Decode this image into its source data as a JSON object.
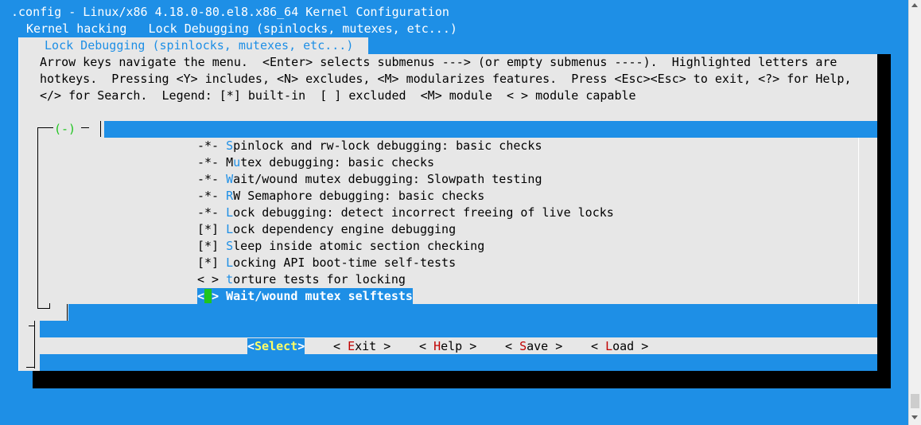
{
  "window": {
    "title": ".config - Linux/x86 4.18.0-80.el8.x86_64 Kernel Configuration",
    "breadcrumb": " Kernel hacking   Lock Debugging (spinlocks, mutexes, etc...)"
  },
  "dialog": {
    "title": " Lock Debugging (spinlocks, mutexes, etc...) ",
    "help_lines": [
      "Arrow keys navigate the menu.  <Enter> selects submenus ---> (or empty submenus ----).  Highlighted letters are",
      "hotkeys.  Pressing <Y> includes, <N> excludes, <M> modularizes features.  Press <Esc><Esc> to exit, <?> for Help,",
      "</> for Search.  Legend: [*] built-in  [ ] excluded  <M> module  < > module capable"
    ],
    "scroll_indicator": "(-)"
  },
  "menu": {
    "items": [
      {
        "prefix": "-*- ",
        "hotkey": "S",
        "rest": "pinlock and rw-lock debugging: basic checks"
      },
      {
        "prefix": "-*- M",
        "hotkey": "u",
        "rest": "tex debugging: basic checks"
      },
      {
        "prefix": "-*- ",
        "hotkey": "W",
        "rest": "ait/wound mutex debugging: Slowpath testing"
      },
      {
        "prefix": "-*- ",
        "hotkey": "R",
        "rest": "W Semaphore debugging: basic checks"
      },
      {
        "prefix": "-*- ",
        "hotkey": "L",
        "rest": "ock debugging: detect incorrect freeing of live locks"
      },
      {
        "prefix": "[*] ",
        "hotkey": "L",
        "rest": "ock dependency engine debugging"
      },
      {
        "prefix": "[*] ",
        "hotkey": "S",
        "rest": "leep inside atomic section checking"
      },
      {
        "prefix": "[*] ",
        "hotkey": "L",
        "rest": "ocking API boot-time self-tests"
      },
      {
        "prefix": "< > ",
        "hotkey": "t",
        "rest": "orture tests for locking"
      }
    ],
    "selected": {
      "open": "<",
      "mark": " ",
      "close": "> ",
      "label": "Wait/wound mutex selftests"
    }
  },
  "buttons": {
    "select": {
      "open": "<",
      "label": "Select",
      "close": ">"
    },
    "exit": {
      "pre": "< ",
      "hotkey": "E",
      "rest": "xit >"
    },
    "help": {
      "pre": "< ",
      "hotkey": "H",
      "rest": "elp >"
    },
    "save": {
      "pre": "< ",
      "hotkey": "S",
      "rest": "ave >"
    },
    "load": {
      "pre": "< ",
      "hotkey": "L",
      "rest": "oad >"
    }
  },
  "colors": {
    "background": "#1e8fe6",
    "dialog": "#e7e7e7",
    "hotkey": "#1e8fe6",
    "button_hotkey": "#c00000",
    "selection_mark": "#1fc51f"
  }
}
